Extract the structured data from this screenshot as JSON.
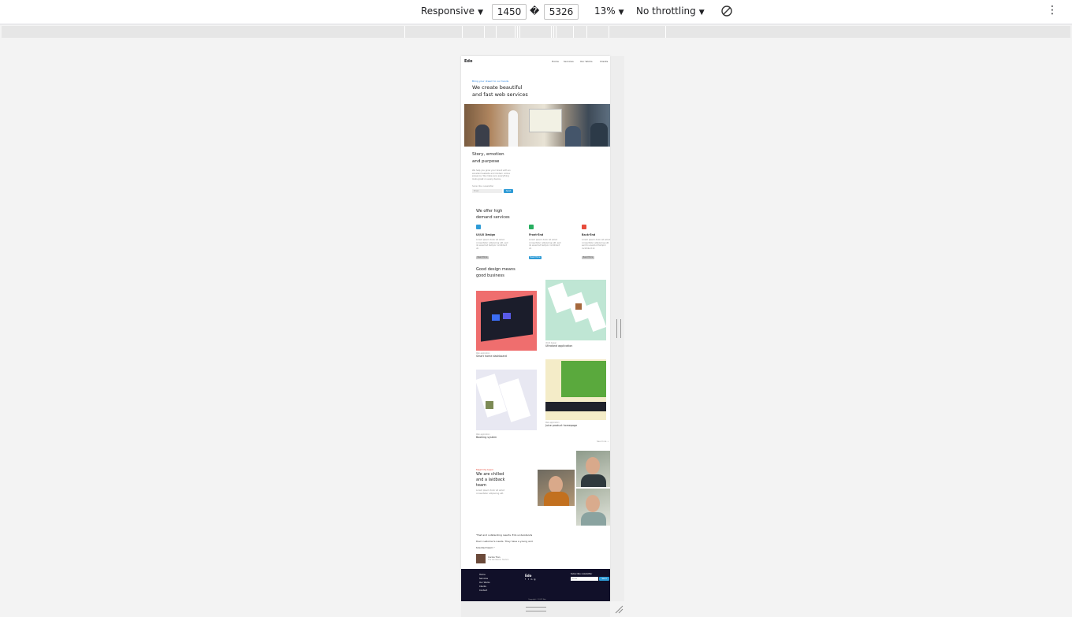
{
  "devtools": {
    "device": "Responsive",
    "width": "1450",
    "dims_separator": "�",
    "height": "5326",
    "zoom": "13%",
    "throttling": "No throttling",
    "more": "⋮"
  },
  "site": {
    "logo": "Edo",
    "nav": [
      "Home",
      "Services",
      "Our Works",
      "Clients"
    ],
    "hero": {
      "kicker": "Bring your dream to our hands",
      "title_line1": "We create beautiful",
      "title_line2": "and fast web services"
    },
    "story": {
      "title_line1": "Story, emotion",
      "title_line2": "and purpose",
      "text": "We help you grow your brand with an excellent website and modern online presence. We make sure everything looks great on every device.",
      "subscribe_label": "Subscribe newsletter",
      "email_placeholder": "Email",
      "subscribe_button": "Send"
    },
    "services": {
      "title_line1": "We offer high",
      "title_line2": "demand services",
      "items": [
        {
          "title": "UI/UX Design",
          "text": "Lorem ipsum dolor sit amet consectetur adipiscing elit, sed do eiusmod tempor incididunt ut.",
          "button": "Read More",
          "color": "#2e9bd6"
        },
        {
          "title": "Front-End",
          "text": "Lorem ipsum dolor sit amet consectetur adipiscing elit, sed do eiusmod tempor incididunt ut.",
          "button": "Read More",
          "color": "#27ae60"
        },
        {
          "title": "Back-End",
          "text": "Lorem ipsum dolor sit amet consectetur adipiscing elit, sed do eiusmod tempor incididunt ut.",
          "button": "Read More",
          "color": "#e74c3c"
        }
      ]
    },
    "works": {
      "title_line1": "Good design means",
      "title_line2": "good business",
      "items": [
        {
          "category": "Web application",
          "title": "Smart home dashboard"
        },
        {
          "category": "UI/UX design",
          "title": "Ultraland application"
        },
        {
          "category": "Web application",
          "title": "Booking system"
        },
        {
          "category": "Web application",
          "title": "Juice product homepage"
        }
      ],
      "see_more": "See more →"
    },
    "team": {
      "kicker": "Meet the team",
      "title_line1": "We are chilled",
      "title_line2": "and a laidback",
      "title_line3": "team",
      "text": "Lorem ipsum dolor sit amet consectetur adipiscing elit."
    },
    "testimonial": {
      "quote_line1": "\"Fast and outstanding results. Edo understands",
      "quote_line2": "their customer's needs. They have a young and",
      "quote_line3": "talented team.\"",
      "author": "Carlos Tran",
      "role": "The Van Resort, Tourism"
    },
    "footer": {
      "logo": "Edo",
      "links": [
        "Home",
        "Services",
        "Our Works",
        "Clients",
        "Contact"
      ],
      "social": [
        "f",
        "t",
        "in",
        "ig"
      ],
      "newsletter_label": "Subscribe newsletter",
      "email_placeholder": "Email",
      "button": "Send",
      "copyright": "Copyright © 2021 Edo"
    }
  }
}
